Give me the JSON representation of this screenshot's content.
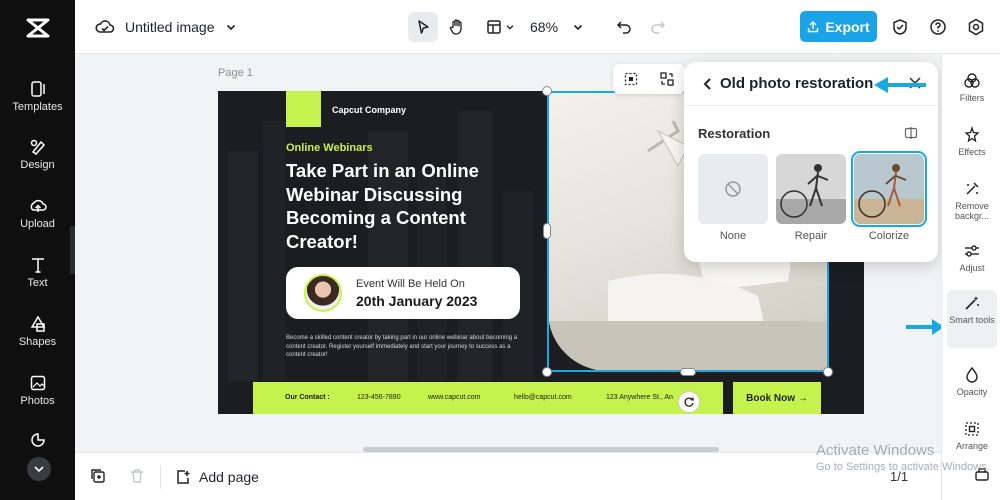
{
  "app": {
    "document_title": "Untitled image",
    "zoom": "68%",
    "export_label": "Export",
    "page_label": "Page 1",
    "add_page_label": "Add page",
    "pager": "1/1"
  },
  "rail": {
    "items": [
      {
        "label": "Templates",
        "icon": "templates-icon"
      },
      {
        "label": "Design",
        "icon": "design-icon"
      },
      {
        "label": "Upload",
        "icon": "upload-icon"
      },
      {
        "label": "Text",
        "icon": "text-icon"
      },
      {
        "label": "Shapes",
        "icon": "shapes-icon"
      },
      {
        "label": "Photos",
        "icon": "photos-icon"
      }
    ]
  },
  "design": {
    "company": "Capcut Company",
    "kicker": "Online Webinars",
    "headline": "Take Part in an Online Webinar Discussing Becoming a Content Creator!",
    "event_line1": "Event Will Be Held On",
    "event_line2": "20th January 2023",
    "blurb": "Become a skilled content creator by taking part in our online webinar about becoming a content creator. Register yourself immediately and start your journey to success as a content creator!",
    "contact_label": "Our Contact :",
    "phone": "123-456-7890",
    "website": "www.capcut.com",
    "email": "hello@capcut.com",
    "address": "123 Anywhere St., An",
    "book_now": "Book Now →"
  },
  "popup": {
    "title": "Old photo restoration",
    "section": "Restoration",
    "options": [
      {
        "label": "None",
        "selected": false
      },
      {
        "label": "Repair",
        "selected": false
      },
      {
        "label": "Colorize",
        "selected": true
      }
    ]
  },
  "right_panel": {
    "items": [
      {
        "label": "Filters",
        "icon": "filters-icon"
      },
      {
        "label": "Effects",
        "icon": "effects-icon"
      },
      {
        "label": "Remove backgr...",
        "icon": "remove-background-icon"
      },
      {
        "label": "Adjust",
        "icon": "adjust-icon"
      },
      {
        "label": "Smart tools",
        "icon": "smart-tools-icon"
      },
      {
        "label": "Opacity",
        "icon": "opacity-icon"
      },
      {
        "label": "Arrange",
        "icon": "arrange-icon"
      }
    ]
  },
  "watermark": {
    "line1": "Activate Windows",
    "line2": "Go to Settings to activate Windows."
  },
  "colors": {
    "accent": "#1aa3e6",
    "lime": "#c6f24e",
    "dark": "#1c1d20"
  }
}
